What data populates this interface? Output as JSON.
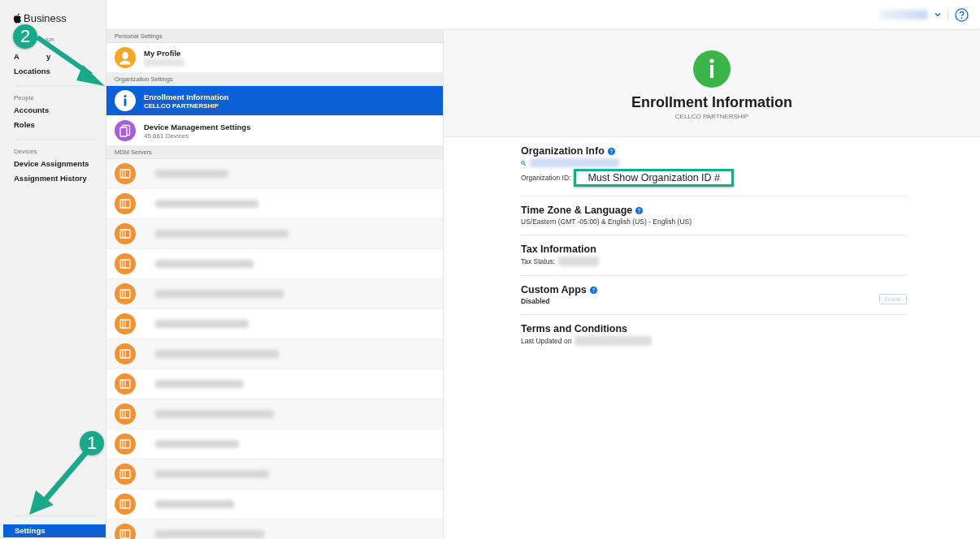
{
  "sidebar": {
    "brand": "Business",
    "groups": [
      {
        "heading_fragment": "ion",
        "items": [
          {
            "label_start": "A",
            "label_end": "y",
            "selected": false
          },
          {
            "label": "Locations",
            "selected": false
          }
        ]
      },
      {
        "heading": "People",
        "items": [
          {
            "label": "Accounts",
            "selected": false
          },
          {
            "label": "Roles",
            "selected": false
          }
        ]
      },
      {
        "heading": "Devices",
        "items": [
          {
            "label": "Device Assignments",
            "selected": false
          },
          {
            "label": "Assignment History",
            "selected": false
          }
        ]
      }
    ],
    "footer_item": {
      "label": "Settings",
      "selected": true
    }
  },
  "settings_list": {
    "sections": [
      {
        "heading": "Personal Settings",
        "rows": [
          {
            "kind": "profile",
            "title": "My Profile",
            "selected": false
          }
        ]
      },
      {
        "heading": "Organization Settings",
        "rows": [
          {
            "kind": "info",
            "title": "Enrollment Information",
            "subtitle": "CELLCO PARTNERSHIP",
            "selected": true
          },
          {
            "kind": "devices",
            "title": "Device Management Settings",
            "subtitle": "45,661 Devices",
            "selected": false
          }
        ]
      },
      {
        "heading": "MDM Servers",
        "rows": [
          {
            "kind": "server",
            "selected": false
          },
          {
            "kind": "server",
            "selected": false
          },
          {
            "kind": "server",
            "selected": false
          },
          {
            "kind": "server",
            "selected": false
          },
          {
            "kind": "server",
            "selected": false
          },
          {
            "kind": "server",
            "selected": false
          },
          {
            "kind": "server",
            "selected": false
          },
          {
            "kind": "server",
            "selected": false
          },
          {
            "kind": "server",
            "selected": false
          },
          {
            "kind": "server",
            "selected": false
          },
          {
            "kind": "server",
            "selected": false
          },
          {
            "kind": "server",
            "selected": false
          },
          {
            "kind": "server",
            "selected": false
          }
        ]
      }
    ]
  },
  "detail": {
    "title": "Enrollment Information",
    "subtitle": "CELLCO PARTNERSHIP",
    "sections": [
      {
        "kind": "org",
        "title": "Organization Info",
        "help": true,
        "label": "Organization ID:"
      },
      {
        "kind": "text",
        "title": "Time Zone & Language",
        "help": true,
        "value": "US/Eastern (GMT -05:00) & English (US) - English (US)"
      },
      {
        "kind": "redacted",
        "title": "Tax Information",
        "label": "Tax Status:"
      },
      {
        "kind": "button",
        "title": "Custom Apps",
        "help": true,
        "value": "Disabled",
        "button": "Enable"
      },
      {
        "kind": "redacted",
        "title": "Terms and Conditions",
        "label": "Last Updated on"
      }
    ]
  },
  "annotations": [
    {
      "number": "2"
    },
    {
      "number": "1"
    }
  ],
  "callout": "Must Show Organization ID #"
}
